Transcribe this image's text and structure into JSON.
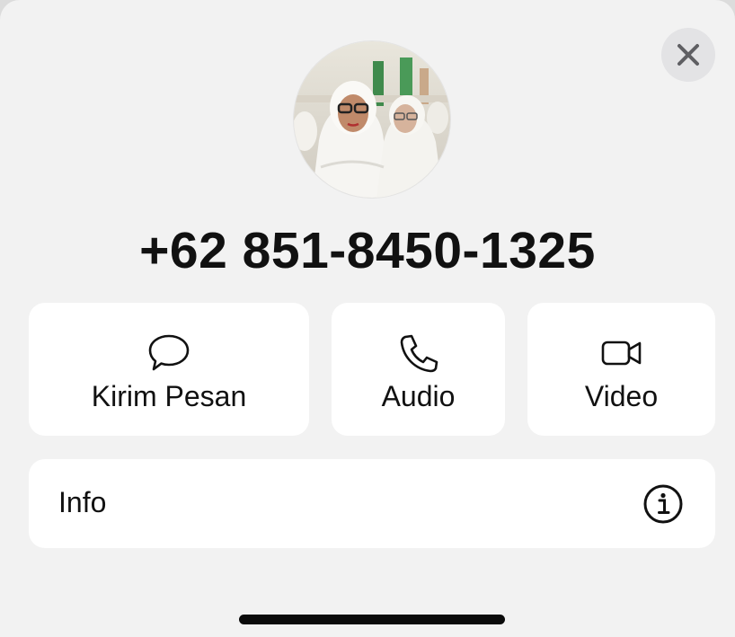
{
  "contact": {
    "phone": "+62 851-8450-1325"
  },
  "actions": [
    {
      "label": "Kirim Pesan",
      "icon": "message-bubble-icon"
    },
    {
      "label": "Audio",
      "icon": "phone-icon"
    },
    {
      "label": "Video",
      "icon": "video-camera-icon"
    }
  ],
  "info": {
    "label": "Info",
    "icon": "info-circle-icon"
  },
  "close": {
    "icon": "close-icon"
  },
  "colors": {
    "sheet_background": "#f2f2f2",
    "card_background": "#ffffff",
    "text": "#111111"
  }
}
